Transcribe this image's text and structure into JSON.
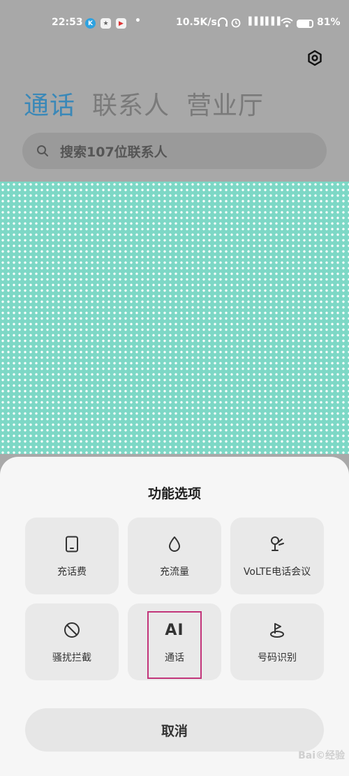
{
  "status_bar": {
    "time": "22:53",
    "app_icons": [
      "K",
      "★",
      "▶"
    ],
    "dot": "•",
    "net_speed": "10.5K/s",
    "signal_1": "▐▐▐",
    "signal_2": "▐▐▐",
    "battery_percent": "81%",
    "battery_level": 0.81,
    "icons": [
      "headphones-icon",
      "alarm-icon",
      "signal-icon",
      "signal-icon",
      "wifi-icon",
      "battery-icon"
    ]
  },
  "header": {
    "tabs": [
      {
        "label": "通话",
        "active": true
      },
      {
        "label": "联系人",
        "active": false
      },
      {
        "label": "营业厅",
        "active": false
      }
    ],
    "settings_icon": "settings-gear-icon"
  },
  "search": {
    "placeholder": "搜索107位联系人",
    "icon": "search-icon"
  },
  "sheet": {
    "title": "功能选项",
    "options": [
      {
        "label": "充话费",
        "icon": "phone-device-icon"
      },
      {
        "label": "充流量",
        "icon": "droplet-icon"
      },
      {
        "label": "VoLTE电话会议",
        "icon": "conference-icon"
      },
      {
        "label": "骚扰拦截",
        "icon": "block-icon"
      },
      {
        "label": "通话",
        "icon_text": "AI",
        "icon": "ai-icon"
      },
      {
        "label": "号码识别",
        "icon": "location-pin-icon"
      }
    ],
    "cancel_label": "取消"
  },
  "watermark": {
    "text": "Bai©经验"
  },
  "colors": {
    "active_tab": "#3a88b8",
    "pattern_bg": "#7dd8c6",
    "highlight": "#c2357a",
    "sheet_bg": "#f6f6f6",
    "tile_bg": "#e9e9e9"
  }
}
